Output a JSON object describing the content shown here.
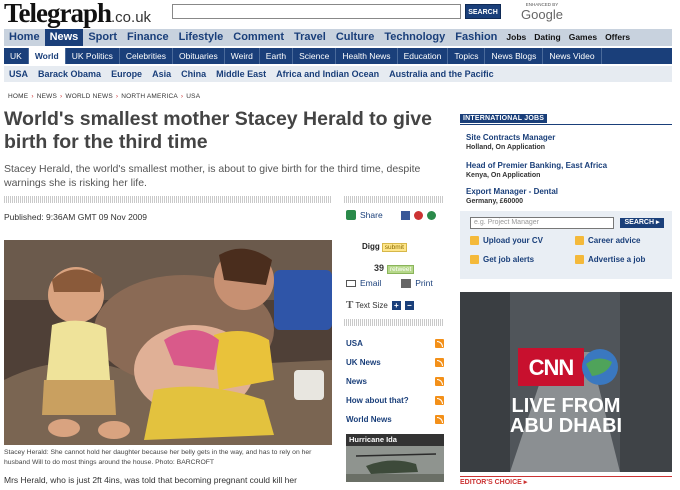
{
  "header": {
    "logo": "Telegraph",
    "logo_suffix": ".co.uk",
    "search_button": "SEARCH",
    "google_small": "ENHANCED BY",
    "google": "Google"
  },
  "nav_main": [
    {
      "label": "Home"
    },
    {
      "label": "News",
      "active": true
    },
    {
      "label": "Sport"
    },
    {
      "label": "Finance"
    },
    {
      "label": "Lifestyle"
    },
    {
      "label": "Comment"
    },
    {
      "label": "Travel"
    },
    {
      "label": "Culture"
    },
    {
      "label": "Technology"
    },
    {
      "label": "Fashion"
    },
    {
      "label": "Jobs",
      "small": true
    },
    {
      "label": "Dating",
      "small": true
    },
    {
      "label": "Games",
      "small": true
    },
    {
      "label": "Offers",
      "small": true
    }
  ],
  "nav_sub": [
    {
      "label": "UK"
    },
    {
      "label": "World",
      "active": true
    },
    {
      "label": "UK Politics"
    },
    {
      "label": "Celebrities"
    },
    {
      "label": "Obituaries"
    },
    {
      "label": "Weird"
    },
    {
      "label": "Earth"
    },
    {
      "label": "Science"
    },
    {
      "label": "Health News"
    },
    {
      "label": "Education"
    },
    {
      "label": "Topics"
    },
    {
      "label": "News Blogs"
    },
    {
      "label": "News Video"
    }
  ],
  "nav_region": [
    "USA",
    "Barack Obama",
    "Europe",
    "Asia",
    "China",
    "Middle East",
    "Africa and Indian Ocean",
    "Australia and the Pacific"
  ],
  "breadcrumb": [
    "HOME",
    "NEWS",
    "WORLD NEWS",
    "NORTH AMERICA",
    "USA"
  ],
  "article": {
    "headline": "World's smallest mother Stacey Herald to give birth for the third time",
    "standfirst": "Stacey Herald, the world's smallest mother, is about to give birth for the third time, despite warnings she is risking her life.",
    "published": "Published: 9:36AM GMT 09 Nov 2009",
    "caption": "Stacey Herald: She cannot hold her daughter because her belly gets in the way, and has to rely on her husband Will to do most things around the house.  Photo: BARCROFT",
    "body": "Mrs Herald, who is just 2ft 4ins, was told that becoming pregnant could kill her"
  },
  "tools": {
    "share": "Share",
    "digg": "Digg",
    "digg_submit": "submit",
    "digg_count": "39",
    "digg_retweet": "retweet",
    "email": "Email",
    "print": "Print",
    "text_size": "Text Size",
    "plus": "+",
    "minus": "−"
  },
  "feeds": [
    "USA",
    "UK News",
    "News",
    "How about that?",
    "World News"
  ],
  "thumb_label": "Hurricane Ida",
  "jobs": {
    "header": "INTERNATIONAL JOBS",
    "items": [
      {
        "title": "Site Contracts Manager",
        "loc": "Holland, On Application"
      },
      {
        "title": "Head of Premier Banking, East Africa",
        "loc": "Kenya, On Application"
      },
      {
        "title": "Export Manager - Dental",
        "loc": "Germany, £60000"
      }
    ],
    "search_placeholder": "e.g. Project Manager",
    "search_button": "SEARCH ▸",
    "links": [
      "Upload your CV",
      "Career advice",
      "Get job alerts",
      "Advertise a job"
    ]
  },
  "ad": {
    "brand": "CNN",
    "line1": "LIVE FROM",
    "line2": "ABU DHABI"
  },
  "editors_choice": "EDITOR'S CHOICE ▸"
}
